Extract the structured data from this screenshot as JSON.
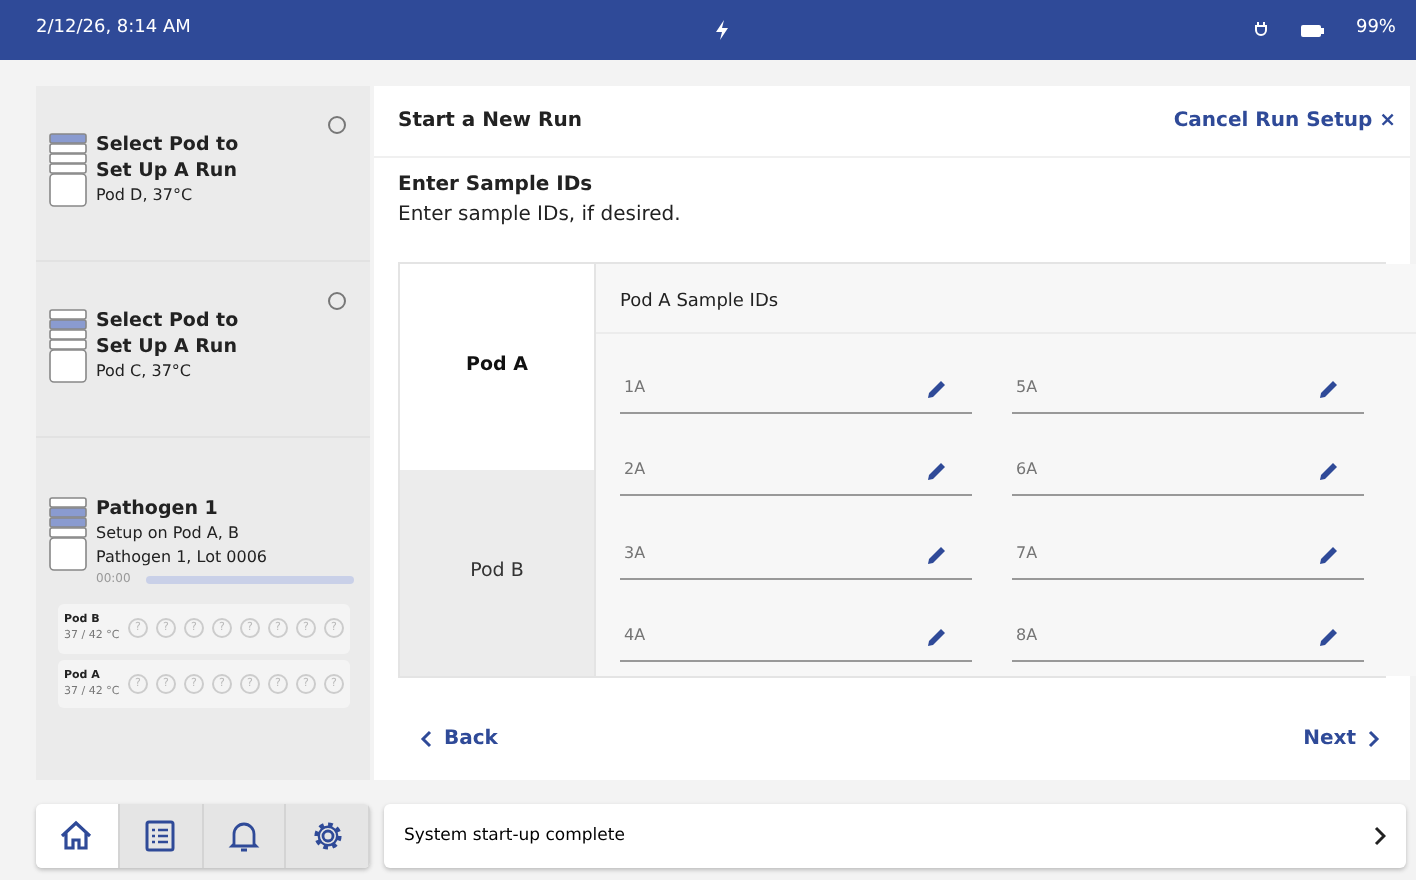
{
  "status_bar": {
    "time": "2/12/26, 8:14 AM",
    "battery": "99%"
  },
  "pods": [
    {
      "kind": "select",
      "title": "Select Pod to Set Up A Run",
      "subtitle": "Pod D, 37°C",
      "slots": [
        {
          "highlighted": true
        },
        {
          "highlighted": false
        },
        {
          "highlighted": false
        },
        {
          "highlighted": false
        }
      ],
      "selected": false
    },
    {
      "kind": "select",
      "title": "Select Pod to Set Up A Run",
      "subtitle": "Pod C, 37°C",
      "slots": [
        {
          "highlighted": false
        },
        {
          "highlighted": true
        },
        {
          "highlighted": false
        },
        {
          "highlighted": false
        }
      ],
      "selected": false
    },
    {
      "kind": "run",
      "title": "Pathogen 1",
      "subtitle": "Setup on Pod A, B",
      "detail": "Pathogen 1, Lot 0006",
      "slots": [
        {
          "highlighted": false
        },
        {
          "highlighted": true
        },
        {
          "highlighted": true
        },
        {
          "highlighted": false
        }
      ],
      "time": "00:00",
      "rows": [
        {
          "name": "Pod B",
          "temp": "37 / 42 °C",
          "wells": [
            "?",
            "?",
            "?",
            "?",
            "?",
            "?",
            "?",
            "?"
          ]
        },
        {
          "name": "Pod A",
          "temp": "37 / 42 °C",
          "wells": [
            "?",
            "?",
            "?",
            "?",
            "?",
            "?",
            "?",
            "?"
          ]
        }
      ]
    }
  ],
  "main": {
    "title": "Start a New Run",
    "cancel": "Cancel Run Setup",
    "cancel_icon": "×",
    "heading": "Enter Sample IDs",
    "hint": "Enter sample IDs, if desired.",
    "pod_tabs": [
      {
        "label": "Pod A",
        "selected": true
      },
      {
        "label": "Pod B",
        "selected": false
      }
    ],
    "panel_title": "Pod A Sample IDs",
    "fields": [
      {
        "placeholder": "1A"
      },
      {
        "placeholder": "2A"
      },
      {
        "placeholder": "3A"
      },
      {
        "placeholder": "4A"
      },
      {
        "placeholder": "5A"
      },
      {
        "placeholder": "6A"
      },
      {
        "placeholder": "7A"
      },
      {
        "placeholder": "8A"
      }
    ],
    "back": "Back",
    "next": "Next"
  },
  "nav": [
    {
      "kind": "home",
      "selected": true
    },
    {
      "kind": "list",
      "selected": false
    },
    {
      "kind": "bell",
      "selected": false
    },
    {
      "kind": "gear",
      "selected": false
    }
  ],
  "notice": "System start-up complete"
}
